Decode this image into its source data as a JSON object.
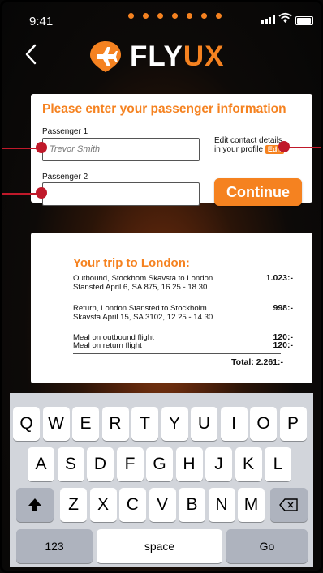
{
  "status": {
    "time": "9:41"
  },
  "brand": {
    "part1": "FLY",
    "part2": "UX"
  },
  "passenger": {
    "title": "Please enter your passenger information",
    "passenger1_label": "Passenger 1",
    "passenger1_value": "Trevor Smith",
    "passenger2_label": "Passenger 2",
    "passenger2_value": "",
    "note_line1": "Edit contact details",
    "note_line2": "in your profile",
    "edit_label": "Edit",
    "continue_label": "Continue"
  },
  "trip": {
    "title": "Your trip to London:",
    "items": [
      {
        "line1": "Outbound, Stockhom Skavsta to London",
        "line2": "Stansted April 6, SA 875, 16.25 - 18.30",
        "price": "1.023:-"
      },
      {
        "line1": "Return, London Stansted to Stockholm",
        "line2": "Skavsta April 15, SA 3102, 12.25 - 14.30",
        "price": "998:-"
      },
      {
        "line1": "Meal on outbound flight",
        "line2": "",
        "price": "120:-"
      },
      {
        "line1": "Meal on return flight",
        "line2": "",
        "price": "120:-"
      }
    ],
    "total": "Total: 2.261:-"
  },
  "keyboard": {
    "row1": [
      "Q",
      "W",
      "E",
      "R",
      "T",
      "Y",
      "U",
      "I",
      "O",
      "P"
    ],
    "row2": [
      "A",
      "S",
      "D",
      "F",
      "G",
      "H",
      "J",
      "K",
      "L"
    ],
    "row3": [
      "Z",
      "X",
      "C",
      "V",
      "B",
      "N",
      "M"
    ],
    "numbers_label": "123",
    "space_label": "space",
    "go_label": "Go"
  },
  "colors": {
    "accent": "#f58220",
    "marker": "#c0192a",
    "keyboard_bg": "#d2d5db"
  }
}
